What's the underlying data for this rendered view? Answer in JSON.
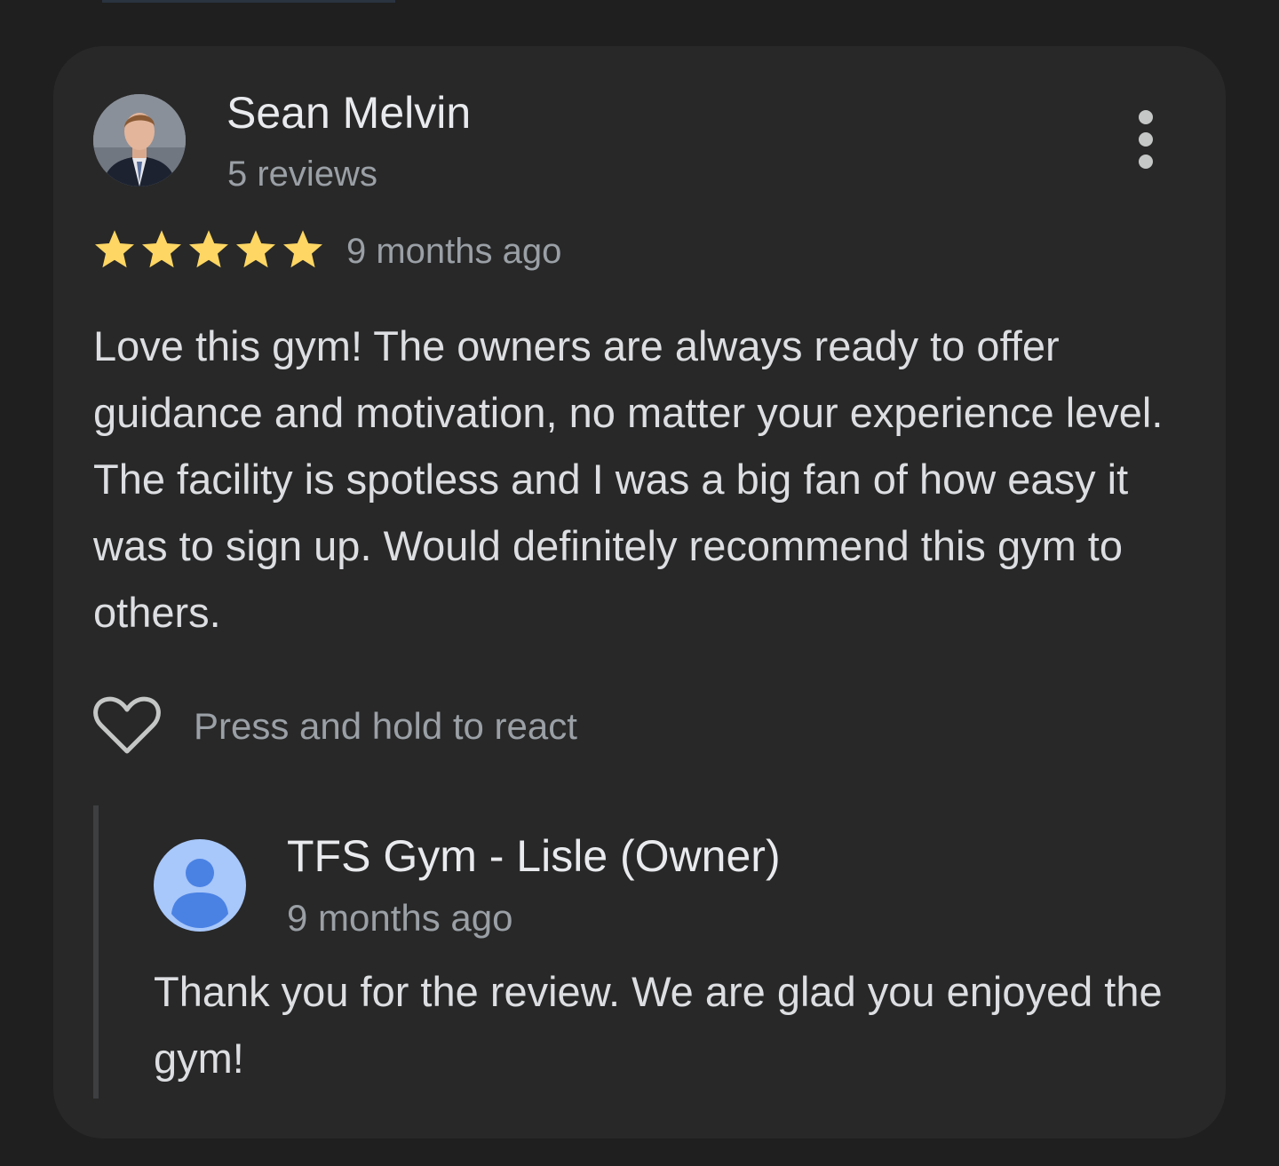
{
  "review": {
    "reviewer_name": "Sean Melvin",
    "reviewer_meta": "5 reviews",
    "rating": 5,
    "date": "9 months ago",
    "text": "Love this gym! The owners are always ready to offer guidance and motivation, no matter your experience level. The facility is spotless and I was a big fan of how easy it was to sign up. Would definitely recommend this gym to others."
  },
  "actions": {
    "react_label": "Press and hold to react",
    "more_icon": "more-vert-icon",
    "react_icon": "heart-outline-icon"
  },
  "reply": {
    "owner_name": "TFS Gym - Lisle (Owner)",
    "date": "9 months ago",
    "text": "Thank you for the review. We are glad you enjoyed the gym!"
  },
  "colors": {
    "background": "#1f1f1f",
    "card": "#282828",
    "star": "#fdd663",
    "primary_text": "#e8eaed",
    "secondary_text": "#9aa0a6",
    "owner_avatar_bg": "#a8c7fa",
    "owner_avatar_fg": "#4a82e4"
  }
}
